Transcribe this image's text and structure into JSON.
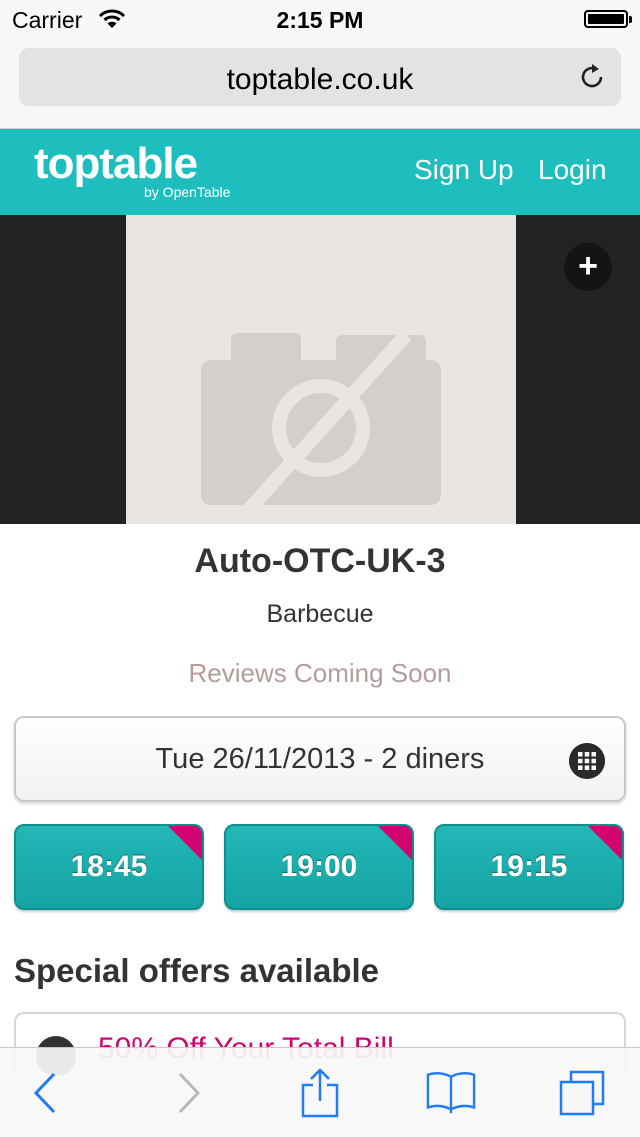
{
  "status_bar": {
    "carrier": "Carrier",
    "time": "2:15 PM"
  },
  "browser": {
    "url": "toptable.co.uk"
  },
  "header": {
    "logo": "toptable",
    "logo_sub": "by OpenTable",
    "sign_up": "Sign Up",
    "login": "Login"
  },
  "restaurant": {
    "name": "Auto-OTC-UK-3",
    "cuisine": "Barbecue",
    "reviews": "Reviews Coming Soon"
  },
  "booking": {
    "date_label": "Tue 26/11/2013 - 2 diners",
    "slots": [
      {
        "time": "18:45"
      },
      {
        "time": "19:00"
      },
      {
        "time": "19:15"
      }
    ]
  },
  "offers": {
    "title": "Special offers available",
    "items": [
      {
        "label": "50% Off Your Total Bill"
      }
    ]
  },
  "colors": {
    "brand_teal": "#1fbebe",
    "offer_magenta": "#d2046f",
    "ios_blue": "#1f7cf5"
  },
  "icons": {
    "wifi": "wifi-icon",
    "battery": "battery-icon",
    "reload": "reload-icon",
    "add_photo": "plus-icon",
    "calendar": "calendar-grid-icon",
    "offer": "offer-icon",
    "back": "chevron-left-icon",
    "forward": "chevron-right-icon",
    "share": "share-icon",
    "bookmarks": "book-icon",
    "tabs": "tabs-icon"
  }
}
